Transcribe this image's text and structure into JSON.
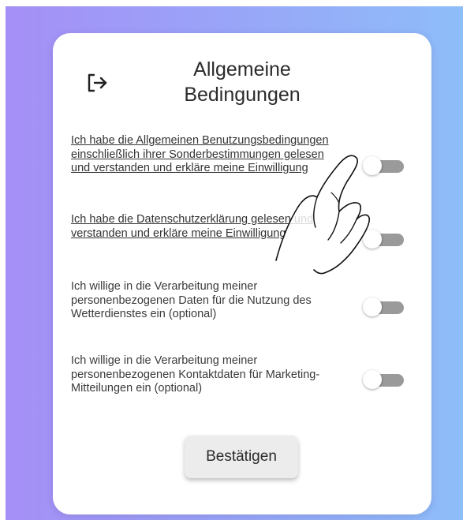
{
  "dialog": {
    "title_line1": "Allgemeine",
    "title_line2": "Bedingungen",
    "logout_icon": "logout-icon",
    "confirm_label": "Bestätigen"
  },
  "consents": [
    {
      "text": "Ich habe die Allgemeinen Benutzungsbedingungen einschließlich ihrer Sonderbestimmungen gelesen und verstanden und erkläre meine Einwilligung",
      "underlined": true,
      "enabled": false
    },
    {
      "text": "Ich habe die Datenschutzerklärung gelesen und verstanden und erkläre meine Einwilligung",
      "underlined": true,
      "enabled": false
    },
    {
      "text": "Ich willige in die Verarbeitung meiner personenbezogenen Daten für die Nutzung des Wetterdienstes ein (optional)",
      "underlined": false,
      "enabled": false
    },
    {
      "text": "Ich willige in die Verarbeitung meiner personenbezogenen Kontaktdaten für Marketing-Mitteilungen ein (optional)",
      "underlined": false,
      "enabled": false
    }
  ],
  "colors": {
    "background_gradient_start": "#a58ff6",
    "background_gradient_end": "#8ebdf9",
    "card": "#ffffff",
    "toggle_track_off": "#9a9a9a",
    "button": "#ececec"
  }
}
